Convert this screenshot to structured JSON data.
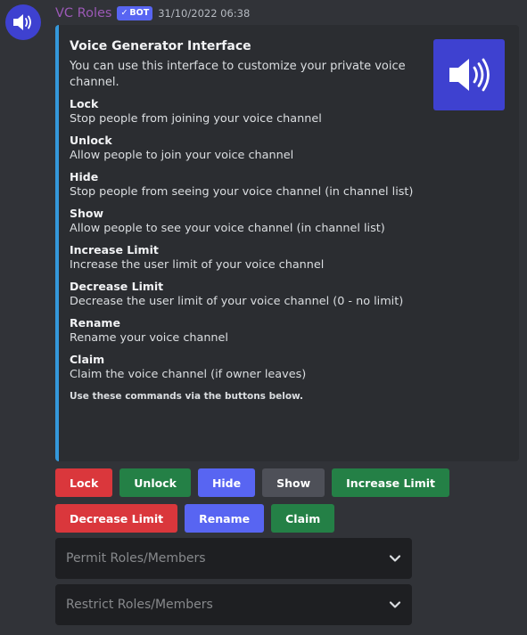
{
  "message": {
    "author": "VC Roles",
    "bot_badge": "BOT",
    "timestamp": "31/10/2022 06:38",
    "avatar_icon": "speaker-icon"
  },
  "embed": {
    "accent_color": "#3498db",
    "title": "Voice Generator Interface",
    "description": "You can use this interface to customize your private voice channel.",
    "thumbnail_icon": "speaker-icon",
    "fields": [
      {
        "name": "Lock",
        "value": "Stop people from joining your voice channel"
      },
      {
        "name": "Unlock",
        "value": "Allow people to join your voice channel"
      },
      {
        "name": "Hide",
        "value": "Stop people from seeing your voice channel (in channel list)"
      },
      {
        "name": "Show",
        "value": "Allow people to see your voice channel (in channel list)"
      },
      {
        "name": "Increase Limit",
        "value": "Increase the user limit of your voice channel"
      },
      {
        "name": "Decrease Limit",
        "value": "Decrease the user limit of your voice channel (0 - no limit)"
      },
      {
        "name": "Rename",
        "value": "Rename your voice channel"
      },
      {
        "name": "Claim",
        "value": "Claim the voice channel (if owner leaves)"
      }
    ],
    "footer": "Use these commands via the buttons below."
  },
  "buttons": {
    "row1": [
      {
        "label": "Lock",
        "style": "danger"
      },
      {
        "label": "Unlock",
        "style": "success"
      },
      {
        "label": "Hide",
        "style": "primary"
      },
      {
        "label": "Show",
        "style": "secondary"
      },
      {
        "label": "Increase Limit",
        "style": "success"
      }
    ],
    "row2": [
      {
        "label": "Decrease Limit",
        "style": "danger"
      },
      {
        "label": "Rename",
        "style": "primary"
      },
      {
        "label": "Claim",
        "style": "success"
      }
    ]
  },
  "selects": [
    {
      "placeholder": "Permit Roles/Members"
    },
    {
      "placeholder": "Restrict Roles/Members"
    }
  ],
  "colors": {
    "danger": "#da373c",
    "success": "#248046",
    "primary": "#5865f2",
    "secondary": "#4e5058",
    "avatar_bg": "#3e41d0",
    "username": "#9b59b6"
  }
}
